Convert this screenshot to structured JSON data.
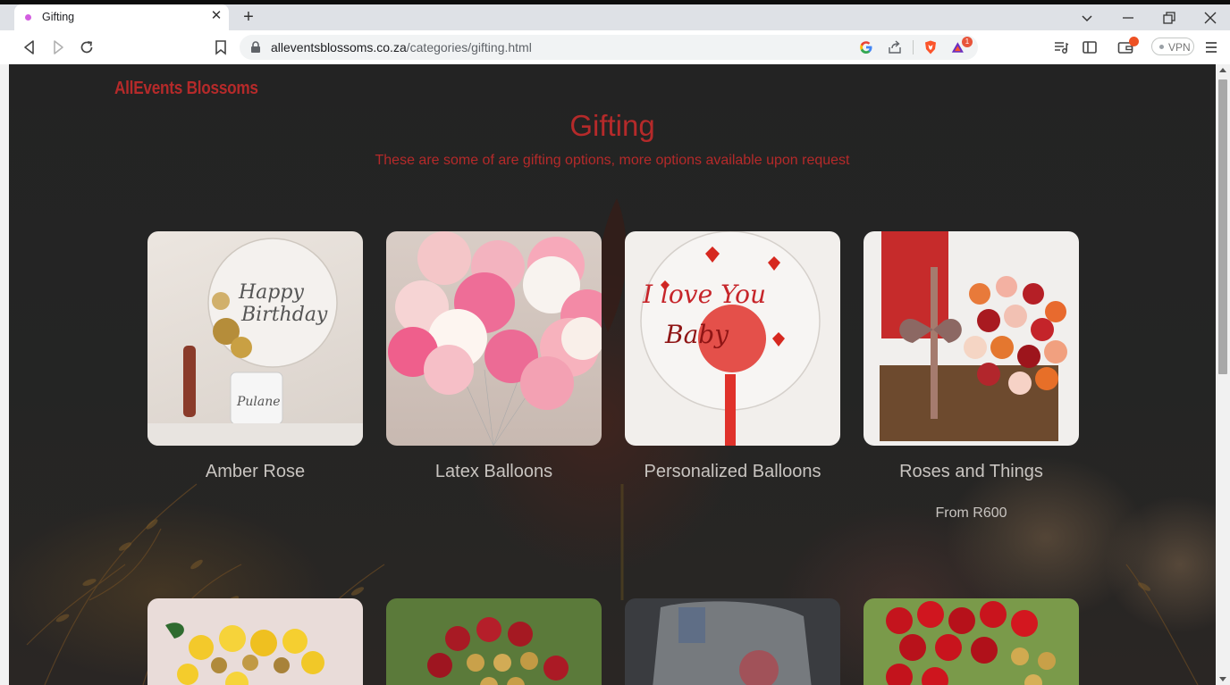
{
  "browser": {
    "tab_title": "Gifting",
    "url_host": "alleventsblossoms.co.za",
    "url_path": "/categories/gifting.html",
    "vpn_label": "VPN",
    "notification_count": "1"
  },
  "site": {
    "brand": "AllEvents Blossoms",
    "title": "Gifting",
    "subtitle": "These are some of are gifting options, more options available upon request",
    "accent_color": "#b52a2a"
  },
  "products": [
    {
      "name": "Amber Rose",
      "price": "",
      "image": "happy-birthday-balloon-gift-photo"
    },
    {
      "name": "Latex Balloons",
      "price": "",
      "image": "pink-latex-balloons-photo"
    },
    {
      "name": "Personalized Balloons",
      "price": "",
      "image": "i-love-you-baby-balloon-photo"
    },
    {
      "name": "Roses and Things",
      "price": "From R600",
      "image": "roses-box-photo"
    },
    {
      "name": "",
      "price": "",
      "image": "yellow-roses-chocolates-photo"
    },
    {
      "name": "",
      "price": "",
      "image": "red-roses-chocolates-heart-photo"
    },
    {
      "name": "",
      "price": "",
      "image": "wrapped-gift-photo"
    },
    {
      "name": "",
      "price": "",
      "image": "red-roses-chocolates-photo"
    }
  ]
}
